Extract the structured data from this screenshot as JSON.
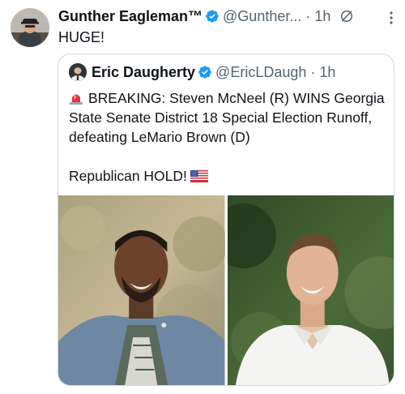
{
  "author": {
    "name": "Gunther Eagleman™",
    "handle": "@Gunther...",
    "time": "1h"
  },
  "tweet": {
    "text": "HUGE!"
  },
  "quoted": {
    "name": "Eric Daugherty",
    "handle": "@EricLDaugh",
    "time": "1h",
    "line1": "BREAKING: Steven McNeel (R) WINS Georgia State Senate District 18 Special Election Runoff, defeating LeMario Brown (D)",
    "line2": "Republican HOLD!"
  },
  "icons": {
    "verified": "verified-badge-icon",
    "no_view": "no-view-icon",
    "more": "more-options-icon",
    "siren": "police-siren-emoji",
    "flag": "us-flag-emoji"
  },
  "colors": {
    "verified_blue": "#1d9bf0",
    "secondary_text": "#536471",
    "border": "#cfd9de"
  }
}
